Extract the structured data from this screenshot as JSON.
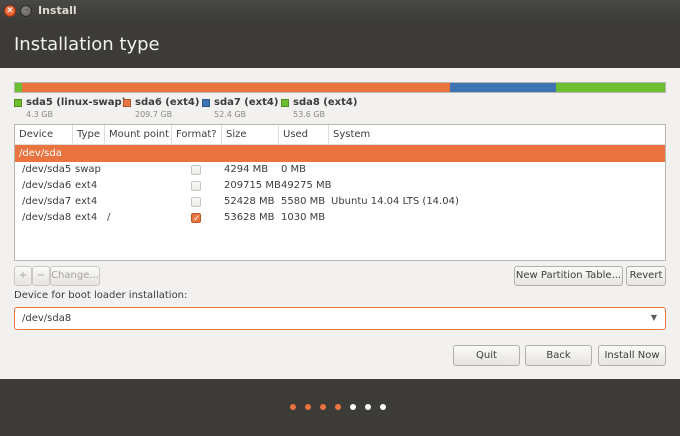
{
  "window": {
    "title": "Install",
    "close_glyph": "✕",
    "minimize_glyph": "–"
  },
  "header": {
    "title": "Installation type"
  },
  "usage_bar": {
    "segments": [
      {
        "color": "#6cbf30",
        "fraction": 0.01
      },
      {
        "color": "#e9743f",
        "fraction": 0.659
      },
      {
        "color": "#3e74b4",
        "fraction": 0.163
      },
      {
        "color": "#6cbf30",
        "fraction": 0.168
      }
    ]
  },
  "legend": [
    {
      "name": "sda5 (linux-swap)",
      "size": "4.3 GB",
      "color": "#6cbf30"
    },
    {
      "name": "sda6 (ext4)",
      "size": "209.7 GB",
      "color": "#e9743f"
    },
    {
      "name": "sda7 (ext4)",
      "size": "52.4 GB",
      "color": "#3e74b4"
    },
    {
      "name": "sda8 (ext4)",
      "size": "53.6 GB",
      "color": "#6cbf30"
    }
  ],
  "table": {
    "columns": [
      "Device",
      "Type",
      "Mount point",
      "Format?",
      "Size",
      "Used",
      "System"
    ],
    "disk_row": "/dev/sda",
    "rows": [
      {
        "device": "/dev/sda5",
        "type": "swap",
        "mount": "",
        "format": false,
        "size": "4294 MB",
        "used": "0 MB",
        "system": ""
      },
      {
        "device": "/dev/sda6",
        "type": "ext4",
        "mount": "",
        "format": false,
        "size": "209715 MB",
        "used": "49275 MB",
        "system": ""
      },
      {
        "device": "/dev/sda7",
        "type": "ext4",
        "mount": "",
        "format": false,
        "size": "52428 MB",
        "used": "5580 MB",
        "system": "Ubuntu 14.04 LTS (14.04)"
      },
      {
        "device": "/dev/sda8",
        "type": "ext4",
        "mount": "/",
        "format": true,
        "size": "53628 MB",
        "used": "1030 MB",
        "system": ""
      }
    ]
  },
  "toolbar": {
    "add": "+",
    "remove": "−",
    "change": "Change...",
    "new_partition_table": "New Partition Table...",
    "revert": "Revert"
  },
  "bootloader": {
    "label": "Device for boot loader installation:",
    "value": "/dev/sda8",
    "arrow_icon": "▼"
  },
  "actions": {
    "quit": "Quit",
    "back": "Back",
    "install_now": "Install Now"
  },
  "progress": {
    "completed_color": "#e9743f",
    "pending_color": "#ffffff",
    "steps_done": 4,
    "steps_total": 7
  }
}
